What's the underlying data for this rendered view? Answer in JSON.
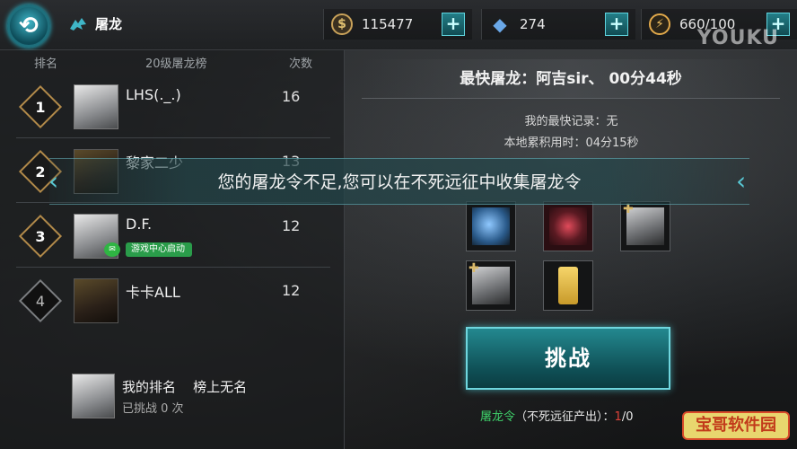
{
  "header": {
    "title": "屠龙",
    "back_icon": "back-arrow-icon",
    "resources": [
      {
        "icon": "coin-icon",
        "symbol": "$",
        "value": "115477",
        "color": "#c9a25a"
      },
      {
        "icon": "crystal-icon",
        "symbol": "◆",
        "value": "274",
        "color": "#6aa8e8"
      },
      {
        "icon": "energy-icon",
        "symbol": "⚡",
        "value": "660/100",
        "color": "#e0a84a"
      }
    ],
    "plus": "+",
    "watermark": "YOUKU"
  },
  "leaderboard": {
    "col_rank": "排名",
    "col_title": "20级屠龙榜",
    "col_count": "次数",
    "rows": [
      {
        "rank": "1",
        "name": "LHS(._.)",
        "count": "16"
      },
      {
        "rank": "2",
        "name": "黎家二少",
        "count": "13"
      },
      {
        "rank": "3",
        "name": "D.F.",
        "count": "12",
        "badge": "游戏中心启动"
      },
      {
        "rank": "4",
        "name": "卡卡ALL",
        "count": "12"
      }
    ],
    "my_rank_label": "我的排名",
    "my_rank_value": "榜上无名",
    "my_challenges": "已挑战 0 次"
  },
  "detail": {
    "fastest": "最快屠龙：阿吉sir、 00分44秒",
    "my_record": "我的最快记录：无",
    "local_time": "本地累积用时：04分15秒",
    "challenge_label": "挑战",
    "token_name": "屠龙令",
    "token_source": "（不死远征产出）：",
    "token_have": "1",
    "token_sep": "/0"
  },
  "toast": {
    "message": "您的屠龙令不足,您可以在不死远征中收集屠龙令"
  },
  "watermark2": "宝哥软件园"
}
